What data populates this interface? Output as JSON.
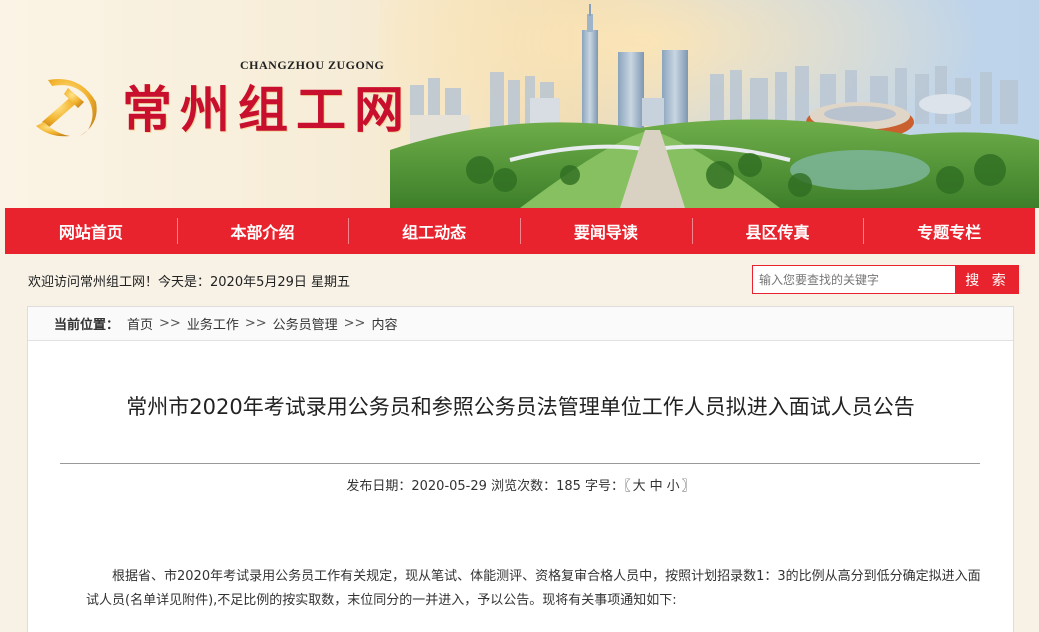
{
  "header": {
    "site_title": "常州组工网",
    "site_subtitle": "CHANGZHOU ZUGONG"
  },
  "nav": {
    "items": [
      "网站首页",
      "本部介绍",
      "组工动态",
      "要闻导读",
      "县区传真",
      "专题专栏"
    ]
  },
  "welcome_text": "欢迎访问常州组工网！今天是：2020年5月29日 星期五",
  "search": {
    "placeholder": "输入您要查找的关键字",
    "button_label": "搜 索"
  },
  "breadcrumb": {
    "label": "当前位置：",
    "items": [
      "首页",
      "业务工作",
      "公务员管理",
      "内容"
    ],
    "separator": ">>"
  },
  "article": {
    "title": "常州市2020年考试录用公务员和参照公务员法管理单位工作人员拟进入面试人员公告",
    "publish_label": "发布日期：",
    "publish_date": "2020-05-29",
    "views_label": "浏览次数：",
    "views": "185",
    "font_label": "字号：",
    "font_open": "〖",
    "font_sizes": [
      "大",
      "中",
      "小"
    ],
    "font_close": "〗",
    "body": "根据省、市2020年考试录用公务员工作有关规定，现从笔试、体能测评、资格复审合格人员中，按照计划招录数1：3的比例从高分到低分确定拟进入面试人员(名单详见附件),不足比例的按实取数，末位同分的一并进入，予以公告。现将有关事项通知如下:"
  },
  "colors": {
    "brand_red": "#e8232e",
    "title_red": "#c8102e",
    "page_bg": "#f7f1e6"
  }
}
